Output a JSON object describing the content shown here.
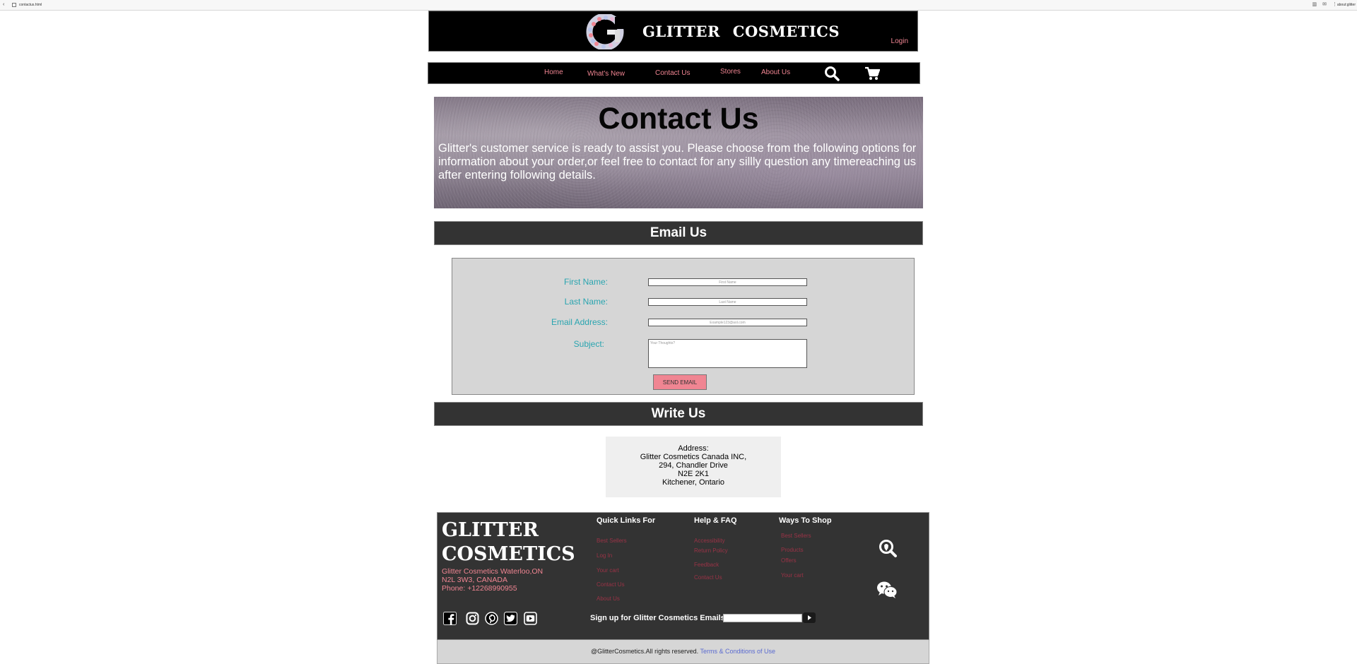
{
  "browser": {
    "url": "contactus.html",
    "right_label": "about:glitter"
  },
  "header": {
    "brand": "GLITTER COSMETICS",
    "login": "Login"
  },
  "nav": {
    "items": [
      "Home",
      "What's New",
      "Contact Us",
      "Stores",
      "About Us"
    ],
    "icons": [
      "search-icon",
      "cart-icon"
    ]
  },
  "hero": {
    "title": "Contact Us",
    "text": "Glitter's customer service is ready to assist you. Please choose from the following options   for  information about your order,or feel free to contact for any sillly question any timereaching us after entering following details."
  },
  "email_section": {
    "title": "Email Us",
    "fields": {
      "first_name_label": "First Name:",
      "first_name_placeholder": "First Name",
      "last_name_label": "Last Name:",
      "last_name_placeholder": "Last Name",
      "email_label": "Email Address:",
      "email_placeholder": "Example123@aol.com",
      "subject_label": "Subject:",
      "subject_placeholder": "Your Thoughts?"
    },
    "send_button": "SEND EMAIL"
  },
  "write_section": {
    "title": "Write Us",
    "address_heading": "Address:",
    "address_lines": [
      "Glitter Cosmetics Canada INC,",
      "294, Chandler Drive",
      "N2E 2K1",
      "Kitchener, Ontario"
    ]
  },
  "footer": {
    "brand_line1": "GLITTER",
    "brand_line2": "COSMETICS",
    "contact_line1": "Glitter Cosmetics Waterloo,ON",
    "contact_line2": "N2L 3W3, CANADA",
    "phone": "Phone: +12268990955",
    "quick_links": {
      "title": "Quick Links For",
      "links": [
        "Best Sellers",
        "Log In",
        "Your cart",
        "Contact Us",
        "About Us"
      ]
    },
    "help": {
      "title": "Help & FAQ",
      "links": [
        "Accessibility",
        "Return Policy",
        "Feedback",
        "Contact Us"
      ]
    },
    "ways": {
      "title": "Ways To Shop",
      "links": [
        "Best Sellers",
        "Products",
        "Offers",
        "Your cart"
      ]
    },
    "social_icons": [
      "facebook-icon",
      "instagram-icon",
      "pinterest-icon",
      "twitter-icon",
      "youtube-icon"
    ],
    "signup_label": "Sign up for Glitter Cosmetics Emails"
  },
  "copyright": {
    "text": "@GlitterCosmetics.All rights reserved. ",
    "terms": "Terms & Conditions of Use"
  },
  "colors": {
    "accent_pink": "#f08592",
    "label_teal": "#2aa5b0",
    "bar_dark": "#333333"
  }
}
